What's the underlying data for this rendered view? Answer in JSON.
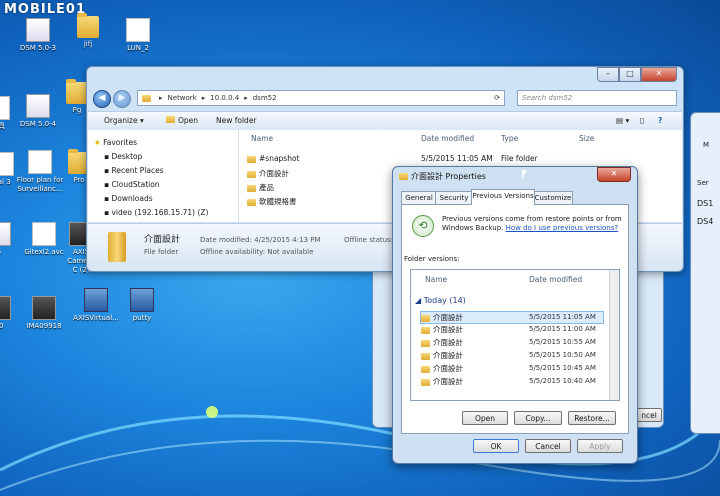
{
  "watermark": "MOBILE01",
  "desktop_icons": [
    {
      "label": "DSM 5.0-3"
    },
    {
      "label": "jifj"
    },
    {
      "label": "LUN_2"
    },
    {
      "label": "DSM 5.0-4"
    },
    {
      "label": "Pg"
    },
    {
      "label": "工具"
    },
    {
      "label": "ual 3"
    },
    {
      "label": "Floor plan for Surveillanc..."
    },
    {
      "label": "Pro"
    },
    {
      "label": "5"
    },
    {
      "label": "Gitexl2.avc"
    },
    {
      "label": "AXIS Camera C (2)"
    },
    {
      "label": "90"
    },
    {
      "label": "IMA09918"
    },
    {
      "label": "AXISVirtual..."
    },
    {
      "label": "putty"
    }
  ],
  "explorer": {
    "address": [
      "Network",
      "10.0.0.4",
      "dsm52"
    ],
    "search_placeholder": "Search dsm52",
    "toolbar": {
      "organize": "Organize ▾",
      "open": "Open",
      "new_folder": "New folder"
    },
    "nav": {
      "favorites": "Favorites",
      "items": [
        "Desktop",
        "Recent Places",
        "CloudStation",
        "Downloads",
        "video (192.168.15.71) (Z)"
      ]
    },
    "columns": {
      "name": "Name",
      "date": "Date modified",
      "type": "Type",
      "size": "Size"
    },
    "files": [
      {
        "name": "#snapshot",
        "date": "5/5/2015 11:05 AM",
        "type": "File folder"
      },
      {
        "name": "介面設計",
        "date": "",
        "type": ""
      },
      {
        "name": "產品",
        "date": "",
        "type": ""
      },
      {
        "name": "軟體規格書",
        "date": "",
        "type": ""
      }
    ],
    "details": {
      "name": "介面設計",
      "type": "File folder",
      "date_label": "Date modified: 4/25/2015 4:13 PM",
      "offline_avail": "Offline availability: Not available",
      "offline_status": "Offline status:"
    }
  },
  "properties": {
    "title": "介面設計 Properties",
    "tabs": [
      "General",
      "Security",
      "Previous Versions",
      "Customize"
    ],
    "description": "Previous versions come from restore points or from Windows Backup.",
    "help_link": "How do I use previous versions?",
    "folder_versions_label": "Folder versions:",
    "col_name": "Name",
    "col_date": "Date modified",
    "group": "Today (14)",
    "versions": [
      {
        "name": "介面設計",
        "date": "5/5/2015 11:05 AM"
      },
      {
        "name": "介面設計",
        "date": "5/5/2015 11:00 AM"
      },
      {
        "name": "介面設計",
        "date": "5/5/2015 10:55 AM"
      },
      {
        "name": "介面設計",
        "date": "5/5/2015 10:50 AM"
      },
      {
        "name": "介面設計",
        "date": "5/5/2015 10:45 AM"
      },
      {
        "name": "介面設計",
        "date": "5/5/2015 10:40 AM"
      }
    ],
    "buttons": {
      "open": "Open",
      "copy": "Copy...",
      "restore": "Restore...",
      "ok": "OK",
      "cancel": "Cancel",
      "apply": "Apply"
    }
  },
  "right_window": {
    "labels": [
      "M",
      "Ser",
      "DS1",
      "DS4"
    ],
    "cancel": "ncel"
  }
}
